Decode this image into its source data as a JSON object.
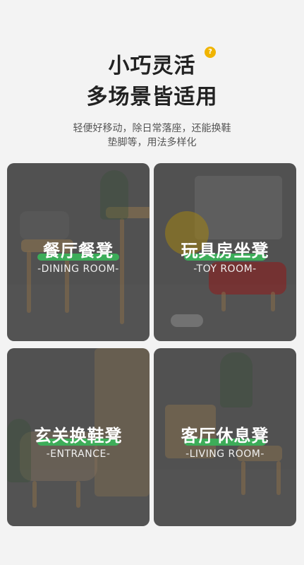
{
  "hero": {
    "title_line_1": "小巧灵活",
    "title_line_2": "多场景皆适用",
    "badge_text": "?",
    "subtitle_line_1": "轻便好移动，除日常落座，还能换鞋",
    "subtitle_line_2": "垫脚等，用法多样化"
  },
  "cards": [
    {
      "title": "餐厅餐凳",
      "subtitle": "-DINING ROOM-"
    },
    {
      "title": "玩具房坐凳",
      "subtitle": "-TOY ROOM-"
    },
    {
      "title": "玄关换鞋凳",
      "subtitle": "-ENTRANCE-"
    },
    {
      "title": "客厅休息凳",
      "subtitle": "-LIVING ROOM-"
    }
  ],
  "colors": {
    "accent_green": "#3bb15a",
    "badge_yellow": "#f0b400"
  }
}
